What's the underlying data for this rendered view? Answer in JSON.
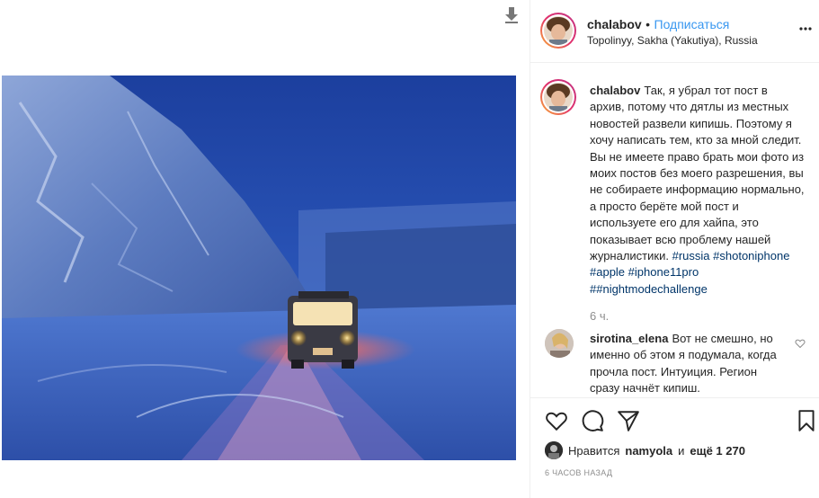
{
  "post": {
    "username": "chalabov",
    "follow_label": "Подписаться",
    "separator": "•",
    "location": "Topolinyy, Sakha (Yakutiya), Russia"
  },
  "caption": {
    "username": "chalabov",
    "text": "Так, я убрал тот пост в архив, потому что дятлы из местных новостей развели кипишь. Поэтому я хочу написать тем, кто за мной следит. Вы не имеете право брать мои фото из моих постов без моего разрешения, вы не собираете информацию нормально, а просто берёте мой пост и используете его для хайпа, это показывает всю проблему нашей журналистики.",
    "hashtags": [
      "#russia",
      "#shotoniphone",
      "#apple",
      "#iphone11pro",
      "##nightmodechallenge"
    ],
    "age": "6 ч."
  },
  "comment": {
    "username": "sirotina_elena",
    "text": "Вот не смешно, но именно об этом я подумала, когда прочла пост. Интуиция. Регион сразу начнёт кипиш."
  },
  "likes": {
    "prefix": "Нравится",
    "user": "namyola",
    "conj": "и",
    "rest": "ещё 1 270"
  },
  "timestamp": "6 часов назад",
  "icons": [
    "download-icon",
    "more-icon",
    "heart-icon",
    "comment-icon",
    "share-icon",
    "bookmark-icon"
  ],
  "colors": {
    "link": "#3897f0",
    "hashtag": "#003569",
    "muted": "#8e8e8e"
  }
}
